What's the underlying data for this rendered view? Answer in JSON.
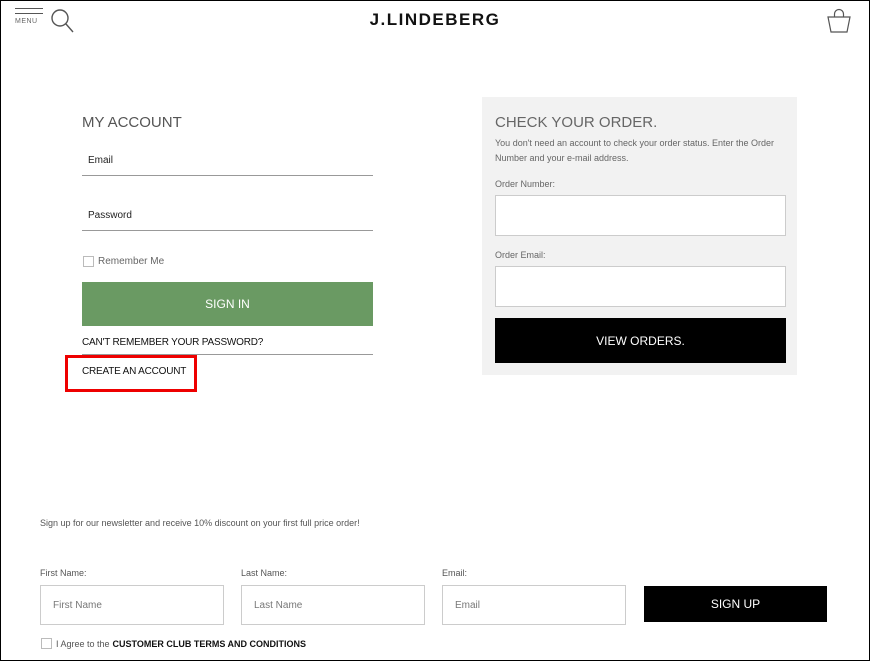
{
  "header": {
    "menu_label": "MENU",
    "brand": "J.LINDEBERG"
  },
  "account": {
    "title": "MY ACCOUNT",
    "email_placeholder": "Email",
    "password_placeholder": "Password",
    "remember_label": "Remember Me",
    "signin_label": "SIGN IN",
    "forgot_label": "CAN'T REMEMBER YOUR PASSWORD?",
    "create_label": "CREATE AN ACCOUNT"
  },
  "order": {
    "title": "CHECK YOUR ORDER.",
    "description": "You don't need an account to check your order status. Enter the Order Number and your e-mail address.",
    "number_label": "Order Number:",
    "email_label": "Order Email:",
    "view_label": "VIEW ORDERS."
  },
  "newsletter": {
    "text": "Sign up for our newsletter and receive 10% discount on your first full price order!",
    "first_label": "First Name:",
    "first_placeholder": "First Name",
    "last_label": "Last Name:",
    "last_placeholder": "Last Name",
    "email_label": "Email:",
    "email_placeholder": "Email",
    "signup_label": "SIGN UP",
    "agree_prefix": "I Agree to the",
    "agree_link": "CUSTOMER CLUB TERMS AND CONDITIONS"
  },
  "colors": {
    "signin": "#6a9a63",
    "highlight": "#ee0000",
    "order_panel": "#f2f2f2"
  }
}
